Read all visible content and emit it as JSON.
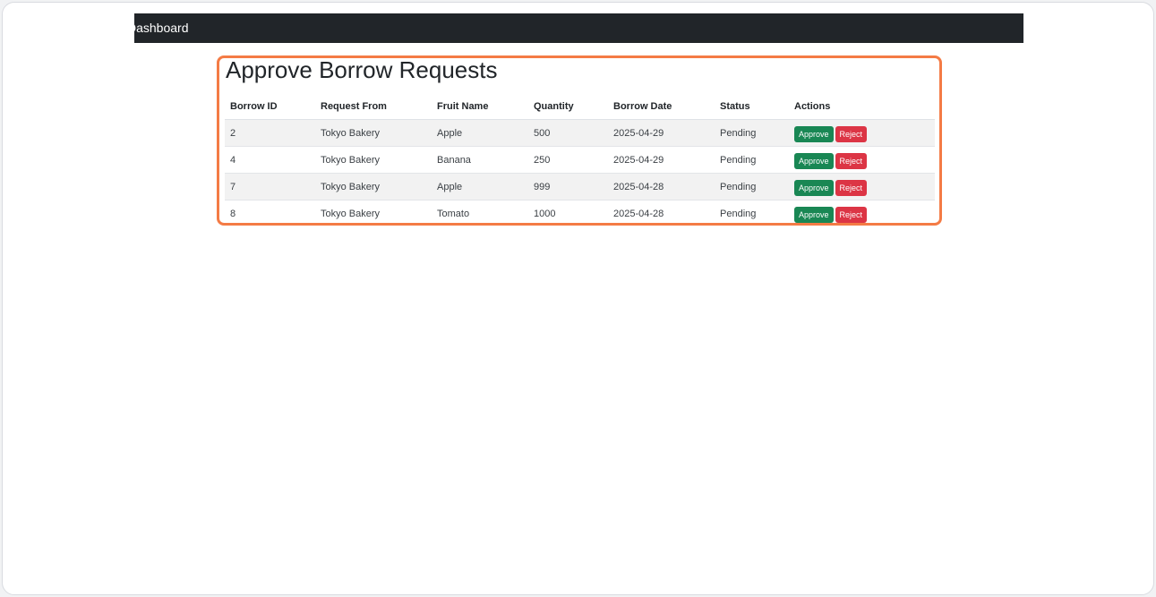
{
  "navbar": {
    "brand": "Dashboard"
  },
  "page": {
    "title": "Approve Borrow Requests"
  },
  "table": {
    "columns": [
      "Borrow ID",
      "Request From",
      "Fruit Name",
      "Quantity",
      "Borrow Date",
      "Status",
      "Actions"
    ],
    "rows": [
      {
        "id": "2",
        "from": "Tokyo Bakery",
        "fruit": "Apple",
        "quantity": "500",
        "date": "2025-04-29",
        "status": "Pending"
      },
      {
        "id": "4",
        "from": "Tokyo Bakery",
        "fruit": "Banana",
        "quantity": "250",
        "date": "2025-04-29",
        "status": "Pending"
      },
      {
        "id": "7",
        "from": "Tokyo Bakery",
        "fruit": "Apple",
        "quantity": "999",
        "date": "2025-04-28",
        "status": "Pending"
      },
      {
        "id": "8",
        "from": "Tokyo Bakery",
        "fruit": "Tomato",
        "quantity": "1000",
        "date": "2025-04-28",
        "status": "Pending"
      }
    ],
    "approve_label": "Approve",
    "reject_label": "Reject"
  },
  "colors": {
    "highlight": "#f47b45",
    "navbar": "#212529",
    "approve": "#198754",
    "reject": "#dc3545"
  }
}
